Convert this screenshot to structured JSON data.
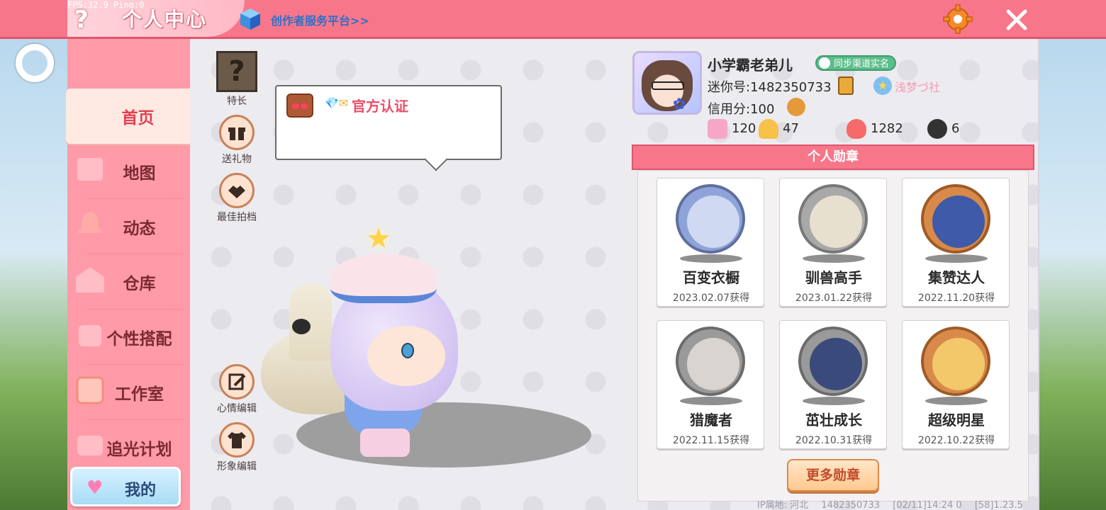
{
  "debug": {
    "fps_text": "FPS:32.9  Ping:0"
  },
  "header": {
    "title": "个人中心",
    "creator_link": "创作者服务平台>>"
  },
  "nav": {
    "items": [
      {
        "label": "首页",
        "icon": "home-icon",
        "active": true
      },
      {
        "label": "地图",
        "icon": "map-icon"
      },
      {
        "label": "动态",
        "icon": "bell-icon"
      },
      {
        "label": "仓库",
        "icon": "warehouse-icon"
      },
      {
        "label": "个性搭配",
        "icon": "outfit-icon"
      },
      {
        "label": "工作室",
        "icon": "studio-icon"
      },
      {
        "label": "追光计划",
        "icon": "spotlight-icon"
      }
    ],
    "mine": {
      "label": "我的",
      "icon": "heart-icon"
    }
  },
  "side_buttons": {
    "specialty": "特长",
    "send_gift": "送礼物",
    "best_partner": "最佳拍档",
    "mood_edit": "心情编辑",
    "look_edit": "形象编辑"
  },
  "bubble": {
    "gem_icons": "💎✉",
    "text": "官方认证"
  },
  "profile": {
    "nickname": "小学霸老弟儿",
    "realname_badge": "同步渠道实名",
    "mini_id": "迷你号:1482350733",
    "clan_name": "浅梦づ社",
    "credit": "信用分:100",
    "stats": [
      {
        "icon": "plus-card-icon",
        "value": "120",
        "color": "#f7a6c8"
      },
      {
        "icon": "fans-icon",
        "value": "47",
        "color": "#f7c24a"
      },
      {
        "icon": "fire-icon",
        "value": "1282",
        "color": "#f76a6a"
      },
      {
        "icon": "hearts-icon",
        "value": "6",
        "color": "#333333"
      }
    ]
  },
  "medals": {
    "header": "个人勋章",
    "items": [
      {
        "name": "百变衣橱",
        "date": "2023.02.07获得",
        "ring": "#8ea3d8",
        "inner": "#cfd9f2"
      },
      {
        "name": "驯兽高手",
        "date": "2023.01.22获得",
        "ring": "#a8a8a8",
        "inner": "#e8e0cf"
      },
      {
        "name": "集赞达人",
        "date": "2022.11.20获得",
        "ring": "#d98a4a",
        "inner": "#3e5aa8"
      },
      {
        "name": "猎魔者",
        "date": "2022.11.15获得",
        "ring": "#9a9a9a",
        "inner": "#d9d4d0"
      },
      {
        "name": "茁壮成长",
        "date": "2022.10.31获得",
        "ring": "#9a9a9a",
        "inner": "#3a4a7a"
      },
      {
        "name": "超级明星",
        "date": "2022.10.22获得",
        "ring": "#d98a4a",
        "inner": "#f2c86a"
      }
    ],
    "more_button": "更多勋章"
  },
  "footer": {
    "ip_location": "IP属地: 河北",
    "uid": "1482350733",
    "time": "[02/11]14:24 0",
    "extra": "[58]1.23.5"
  }
}
